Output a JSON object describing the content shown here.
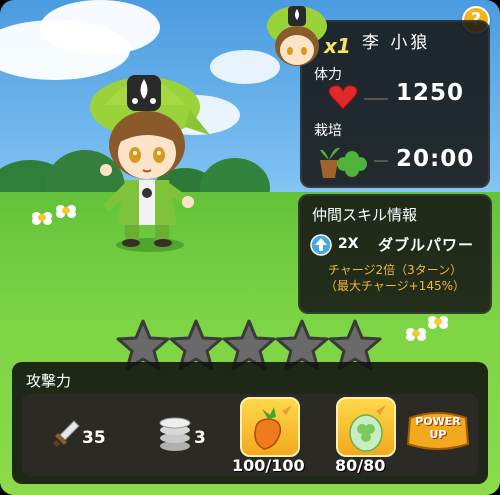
{
  "help": {
    "label": "?"
  },
  "card": {
    "multiplier": "x1",
    "name": "李 小狼",
    "hp_label": "体力",
    "hp_value": "1250",
    "grow_label": "栽培",
    "grow_value": "20:00"
  },
  "skill": {
    "title": "仲間スキル情報",
    "level": "2X",
    "name": "ダブルパワー",
    "desc_line1": "チャージ2倍（3ターン）",
    "desc_line2": "（最大チャージ+145%）"
  },
  "stars": {
    "filled": 0,
    "total": 5
  },
  "attack": {
    "label": "攻撃力",
    "sword_count": "35",
    "coin_count": "3",
    "carrot_progress": "100/100",
    "egg_progress": "80/80",
    "power_up_line1": "POWER",
    "power_up_line2": "UP"
  },
  "colors": {
    "panel_bg": "#161614",
    "accent_gold": "#f2b41c",
    "desc_orange": "#f3b53c",
    "grass": "#7cd444",
    "sky": "#7cc0f2"
  }
}
